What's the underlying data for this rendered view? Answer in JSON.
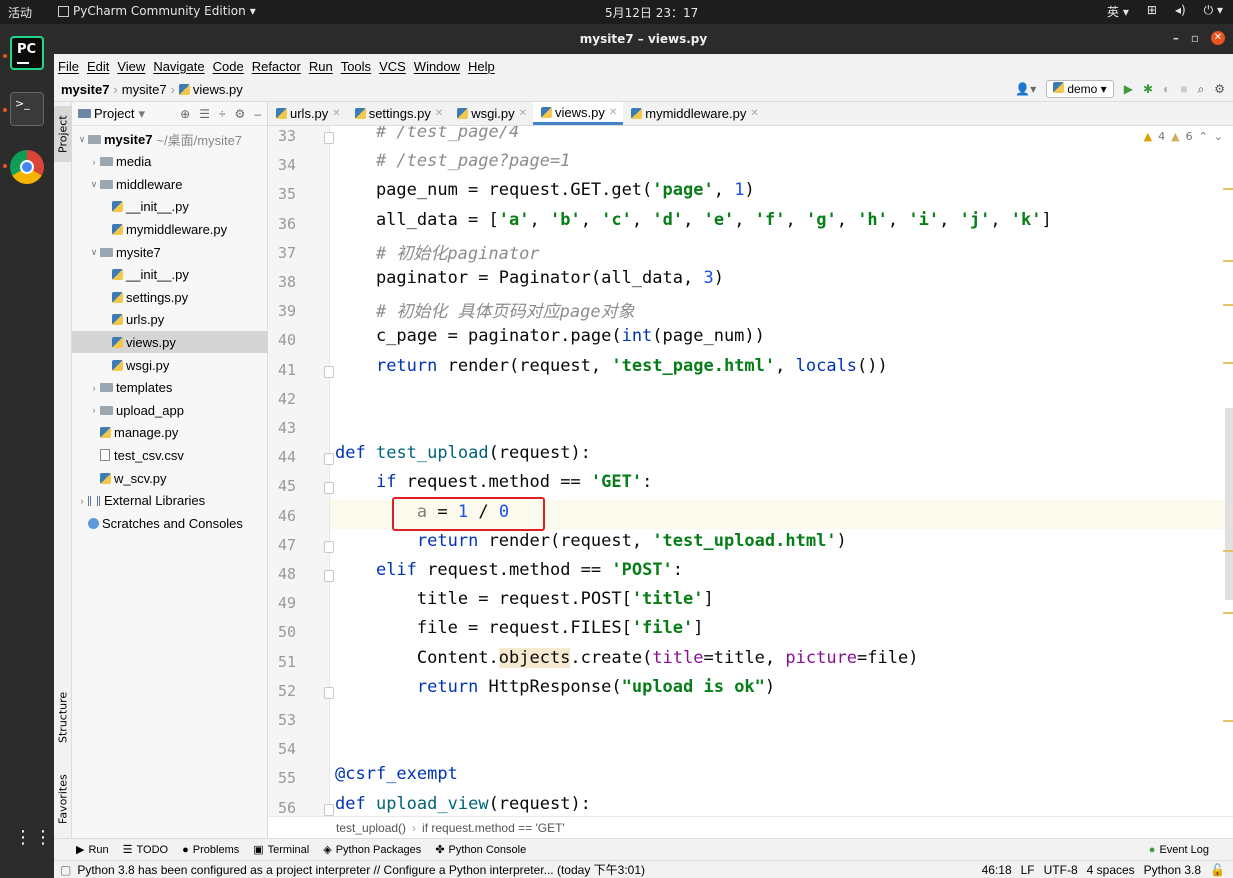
{
  "os_top_bar": {
    "activities": "活动",
    "app_name": "PyCharm Community Edition",
    "clock": "5月12日 23：17",
    "input_method": "英"
  },
  "window": {
    "title": "mysite7 – views.py"
  },
  "menu": [
    "File",
    "Edit",
    "View",
    "Navigate",
    "Code",
    "Refactor",
    "Run",
    "Tools",
    "VCS",
    "Window",
    "Help"
  ],
  "nav_breadcrumb": [
    "mysite7",
    "mysite7",
    "views.py"
  ],
  "run_config": "demo",
  "project_panel": {
    "title": "Project",
    "items": [
      {
        "label": "mysite7",
        "extra": "~/桌面/mysite7",
        "kind": "folder",
        "depth": 0,
        "open": true,
        "bold": true
      },
      {
        "label": "media",
        "kind": "folder",
        "depth": 1,
        "open": false
      },
      {
        "label": "middleware",
        "kind": "folder",
        "depth": 1,
        "open": true
      },
      {
        "label": "__init__.py",
        "kind": "py",
        "depth": 2
      },
      {
        "label": "mymiddleware.py",
        "kind": "py",
        "depth": 2
      },
      {
        "label": "mysite7",
        "kind": "folder",
        "depth": 1,
        "open": true
      },
      {
        "label": "__init__.py",
        "kind": "py",
        "depth": 2
      },
      {
        "label": "settings.py",
        "kind": "py",
        "depth": 2
      },
      {
        "label": "urls.py",
        "kind": "py",
        "depth": 2
      },
      {
        "label": "views.py",
        "kind": "py",
        "depth": 2,
        "selected": true
      },
      {
        "label": "wsgi.py",
        "kind": "py",
        "depth": 2
      },
      {
        "label": "templates",
        "kind": "folder",
        "depth": 1,
        "open": false
      },
      {
        "label": "upload_app",
        "kind": "folder",
        "depth": 1,
        "open": false
      },
      {
        "label": "manage.py",
        "kind": "py",
        "depth": 1
      },
      {
        "label": "test_csv.csv",
        "kind": "csv",
        "depth": 1
      },
      {
        "label": "w_scv.py",
        "kind": "py",
        "depth": 1
      },
      {
        "label": "External Libraries",
        "kind": "lib",
        "depth": 0,
        "open": false
      },
      {
        "label": "Scratches and Consoles",
        "kind": "scratch",
        "depth": 0
      }
    ]
  },
  "side_tabs": {
    "project": "Project",
    "structure": "Structure",
    "favorites": "Favorites"
  },
  "editor_tabs": [
    {
      "label": "urls.py",
      "active": false
    },
    {
      "label": "settings.py",
      "active": false
    },
    {
      "label": "wsgi.py",
      "active": false
    },
    {
      "label": "views.py",
      "active": true
    },
    {
      "label": "mymiddleware.py",
      "active": false
    }
  ],
  "inspections": {
    "warnings": "4",
    "weak_warnings": "6"
  },
  "line_numbers": [
    "33",
    "34",
    "35",
    "36",
    "37",
    "38",
    "39",
    "40",
    "41",
    "42",
    "43",
    "44",
    "45",
    "46",
    "47",
    "48",
    "49",
    "50",
    "51",
    "52",
    "53",
    "54",
    "55",
    "56"
  ],
  "code_lines": [
    [
      {
        "t": "    "
      },
      {
        "t": "# /test_page/4",
        "c": "cmt"
      }
    ],
    [
      {
        "t": "    "
      },
      {
        "t": "# /test_page?page=1",
        "c": "cmt"
      }
    ],
    [
      {
        "t": "    page_num = request.GET.get("
      },
      {
        "t": "'page'",
        "c": "str"
      },
      {
        "t": ", "
      },
      {
        "t": "1",
        "c": "num"
      },
      {
        "t": ")"
      }
    ],
    [
      {
        "t": "    all_data = ["
      },
      {
        "t": "'a'",
        "c": "str"
      },
      {
        "t": ", "
      },
      {
        "t": "'b'",
        "c": "str"
      },
      {
        "t": ", "
      },
      {
        "t": "'c'",
        "c": "str"
      },
      {
        "t": ", "
      },
      {
        "t": "'d'",
        "c": "str"
      },
      {
        "t": ", "
      },
      {
        "t": "'e'",
        "c": "str"
      },
      {
        "t": ", "
      },
      {
        "t": "'f'",
        "c": "str"
      },
      {
        "t": ", "
      },
      {
        "t": "'g'",
        "c": "str"
      },
      {
        "t": ", "
      },
      {
        "t": "'h'",
        "c": "str"
      },
      {
        "t": ", "
      },
      {
        "t": "'i'",
        "c": "str"
      },
      {
        "t": ", "
      },
      {
        "t": "'j'",
        "c": "str"
      },
      {
        "t": ", "
      },
      {
        "t": "'k'",
        "c": "str"
      },
      {
        "t": "]"
      }
    ],
    [
      {
        "t": "    "
      },
      {
        "t": "# 初始化paginator",
        "c": "cmt"
      }
    ],
    [
      {
        "t": "    paginator = Paginator(all_data, "
      },
      {
        "t": "3",
        "c": "num"
      },
      {
        "t": ")"
      }
    ],
    [
      {
        "t": "    "
      },
      {
        "t": "# 初始化 具体页码对应page对象",
        "c": "cmt"
      }
    ],
    [
      {
        "t": "    c_page = paginator.page("
      },
      {
        "t": "int",
        "c": "kw"
      },
      {
        "t": "(page_num))"
      }
    ],
    [
      {
        "t": "    "
      },
      {
        "t": "return",
        "c": "kw"
      },
      {
        "t": " render(request, "
      },
      {
        "t": "'test_page.html'",
        "c": "str"
      },
      {
        "t": ", "
      },
      {
        "t": "locals",
        "c": "kw"
      },
      {
        "t": "())"
      }
    ],
    [],
    [],
    [
      {
        "t": "def",
        "c": "kw"
      },
      {
        "t": " "
      },
      {
        "t": "test_upload",
        "c": "fn"
      },
      {
        "t": "(request):"
      }
    ],
    [
      {
        "t": "    "
      },
      {
        "t": "if",
        "c": "kw"
      },
      {
        "t": " request.method == "
      },
      {
        "t": "'GET'",
        "c": "str"
      },
      {
        "t": ":"
      }
    ],
    [
      {
        "t": "        "
      },
      {
        "t": "a",
        "c": "grey"
      },
      {
        "t": " = "
      },
      {
        "t": "1",
        "c": "num"
      },
      {
        "t": " / "
      },
      {
        "t": "0",
        "c": "num"
      }
    ],
    [
      {
        "t": "        "
      },
      {
        "t": "return",
        "c": "kw"
      },
      {
        "t": " render(request, "
      },
      {
        "t": "'test_upload.html'",
        "c": "str"
      },
      {
        "t": ")"
      }
    ],
    [
      {
        "t": "    "
      },
      {
        "t": "elif",
        "c": "kw"
      },
      {
        "t": " request.method == "
      },
      {
        "t": "'POST'",
        "c": "str"
      },
      {
        "t": ":"
      }
    ],
    [
      {
        "t": "        title = request.POST["
      },
      {
        "t": "'title'",
        "c": "str"
      },
      {
        "t": "]"
      }
    ],
    [
      {
        "t": "        file = request.FILES["
      },
      {
        "t": "'file'",
        "c": "str"
      },
      {
        "t": "]"
      }
    ],
    [
      {
        "t": "        Content."
      },
      {
        "t": "objects",
        "c": "hl"
      },
      {
        "t": ".create("
      },
      {
        "t": "title",
        "c": "param"
      },
      {
        "t": "=title, "
      },
      {
        "t": "picture",
        "c": "param"
      },
      {
        "t": "=file)"
      }
    ],
    [
      {
        "t": "        "
      },
      {
        "t": "return",
        "c": "kw"
      },
      {
        "t": " HttpResponse("
      },
      {
        "t": "\"upload is ok\"",
        "c": "str"
      },
      {
        "t": ")"
      }
    ],
    [],
    [],
    [
      {
        "t": "@csrf_exempt",
        "c": "kw"
      }
    ],
    [
      {
        "t": "def",
        "c": "kw"
      },
      {
        "t": " "
      },
      {
        "t": "upload_view",
        "c": "fn"
      },
      {
        "t": "(request):"
      }
    ]
  ],
  "code_breadcrumb": [
    "test_upload()",
    "if request.method == 'GET'"
  ],
  "bottom_tools": [
    "Run",
    "TODO",
    "Problems",
    "Terminal",
    "Python Packages",
    "Python Console"
  ],
  "event_log": "Event Log",
  "status": {
    "message": "Python 3.8 has been configured as a project interpreter // Configure a Python interpreter... (today 下午3:01)",
    "position": "46:18",
    "line_sep": "LF",
    "encoding": "UTF-8",
    "indent": "4 spaces",
    "interpreter": "Python 3.8"
  },
  "colors": {
    "accent": "#4083c9",
    "highlight_box": "#e02020",
    "os_accent": "#e95420"
  }
}
